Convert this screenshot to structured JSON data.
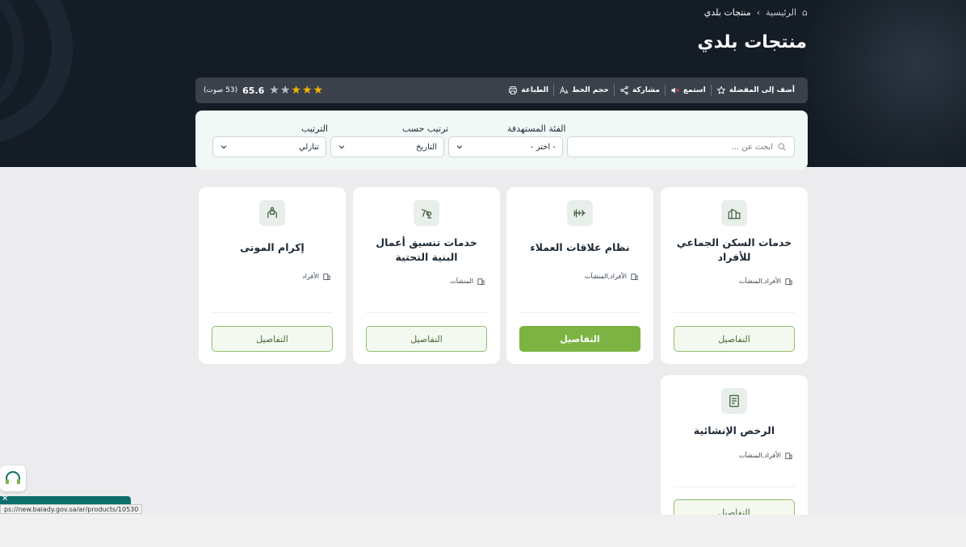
{
  "breadcrumb": {
    "home": "الرئيسية",
    "current": "منتجات بلدي"
  },
  "page_title": "منتجات بلدي",
  "rating": {
    "score": "65.6",
    "votes": "(53 صوت)",
    "stars_filled": 3,
    "stars_total": 5
  },
  "actions": {
    "favorite": "أضف إلى المفضلة",
    "listen": "استمع",
    "share": "مشاركة",
    "font_size": "حجم الخط",
    "print": "الطباعة"
  },
  "filters": {
    "search_placeholder": "ابحث عن ...",
    "category_label": "الفئة المستهدفة",
    "category_value": "- اختر -",
    "sort_by_label": "ترتيب حسب",
    "sort_by_value": "التاريخ",
    "order_label": "الترتيب",
    "order_value": "تنازلي"
  },
  "cards": [
    {
      "title": "خدمات السكن الجماعي للأفراد",
      "tags": "الأفراد,المنشآت",
      "button": "التفاصيل",
      "icon": "building-icon"
    },
    {
      "title": "نظام علاقات العملاء",
      "tags": "الأفراد,المنشآت",
      "button": "التفاصيل",
      "icon": "crm-icon"
    },
    {
      "title": "خدمات تنسيق أعمال البنية التحتية",
      "tags": "المنشآت",
      "button": "التفاصيل",
      "icon": "infrastructure-icon"
    },
    {
      "title": "إكرام الموتى",
      "tags": "الأفراد",
      "button": "التفاصيل",
      "icon": "hands-icon"
    },
    {
      "title": "الرخص الإنشائية",
      "tags": "الأفراد,المنشآت",
      "button": "التفاصيل",
      "icon": "document-icon"
    }
  ],
  "status_url": "ps://new.balady.gov.sa/ar/products/10530",
  "colors": {
    "hero": "#141c26",
    "accent_green": "#7cb342",
    "star": "#f5b301",
    "teal": "#0d6e6b"
  }
}
